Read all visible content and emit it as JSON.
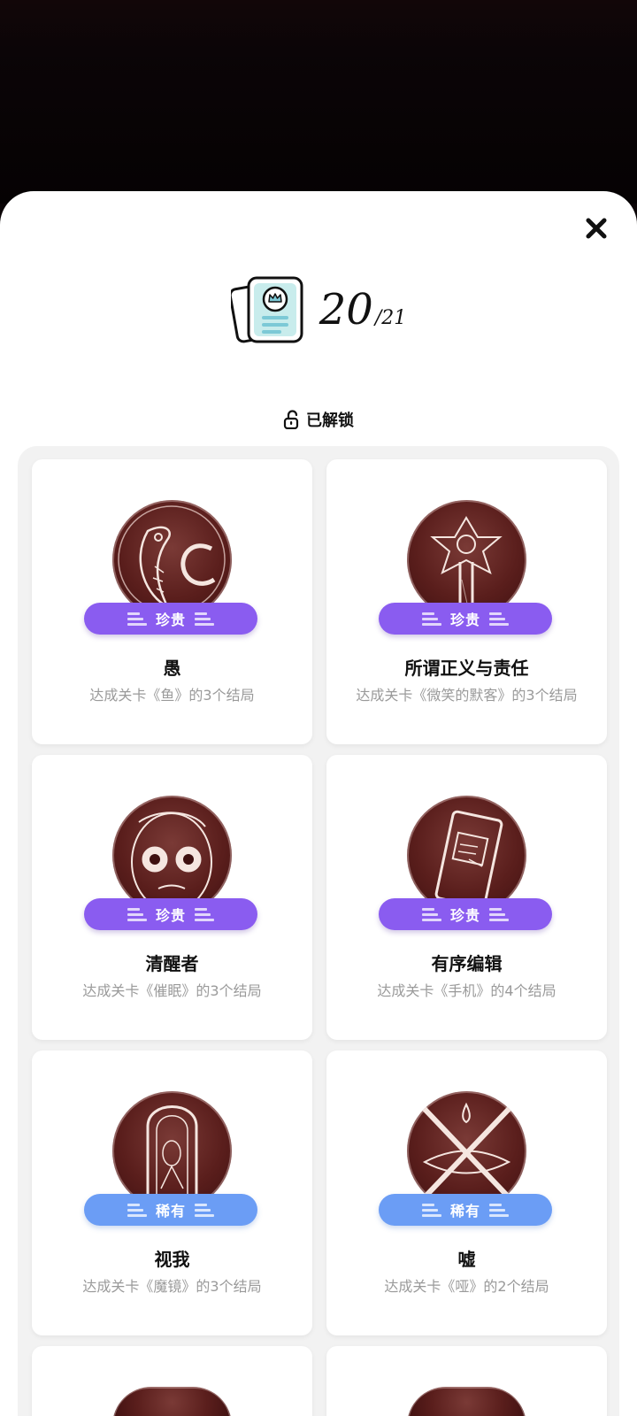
{
  "header": {
    "count": "20",
    "separator": "/",
    "total": "21"
  },
  "unlocked_label": "已解锁",
  "achievements": [
    {
      "title": "愚",
      "rarity": "珍贵",
      "description": "达成关卡《鱼》的3个结局"
    },
    {
      "title": "所谓正义与责任",
      "rarity": "珍贵",
      "description": "达成关卡《微笑的默客》的3个结局"
    },
    {
      "title": "清醒者",
      "rarity": "珍贵",
      "description": "达成关卡《催眠》的3个结局"
    },
    {
      "title": "有序编辑",
      "rarity": "珍贵",
      "description": "达成关卡《手机》的4个结局"
    },
    {
      "title": "视我",
      "rarity": "稀有",
      "description": "达成关卡《魔镜》的3个结局"
    },
    {
      "title": "嘘",
      "rarity": "稀有",
      "description": "达成关卡《哑》的2个结局"
    }
  ],
  "colors": {
    "precious_badge": "#8a5cf0",
    "rare_badge": "#6b9df5",
    "medal": "#5a1e1c",
    "sheet": "#ffffff"
  },
  "icons": [
    "close-icon",
    "album-icon",
    "unlock-icon"
  ]
}
